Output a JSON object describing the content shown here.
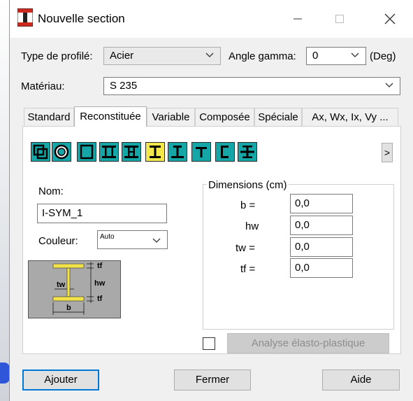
{
  "window": {
    "title": "Nouvelle section",
    "minimize": "—",
    "maximize": "☐",
    "close": "✕"
  },
  "profile_type": {
    "label": "Type de profilé:",
    "value": "Acier"
  },
  "angle_gamma": {
    "label": "Angle gamma:",
    "value": "0",
    "unit": "(Deg)"
  },
  "material": {
    "label": "Matériau:",
    "value": "S 235"
  },
  "tabs": [
    {
      "label": "Standard",
      "active": false
    },
    {
      "label": "Reconstituée",
      "active": true
    },
    {
      "label": "Variable",
      "active": false
    },
    {
      "label": "Composée",
      "active": false
    },
    {
      "label": "Spéciale",
      "active": false
    },
    {
      "label": "Ax, Wx, Ix, Vy ...",
      "active": false
    }
  ],
  "section_types": [
    {
      "icon": "box-section-icon",
      "selected": false
    },
    {
      "icon": "circular-tube-icon",
      "selected": false
    },
    {
      "icon": "rectangular-box-icon",
      "selected": false
    },
    {
      "icon": "double-web-box-icon",
      "selected": false
    },
    {
      "icon": "box-with-flanges-icon",
      "selected": false
    },
    {
      "icon": "i-symmetric-icon",
      "selected": true
    },
    {
      "icon": "i-asymmetric-icon",
      "selected": false
    },
    {
      "icon": "t-section-icon",
      "selected": false
    },
    {
      "icon": "c-channel-icon",
      "selected": false
    },
    {
      "icon": "cross-section-icon",
      "selected": false
    }
  ],
  "scroll_right": ">",
  "name": {
    "label": "Nom:",
    "value": "I-SYM_1"
  },
  "color": {
    "label": "Couleur:",
    "value": "Auto"
  },
  "diagram": {
    "tf_top": "tf",
    "hw": "hw",
    "tw": "tw",
    "tf_bottom": "tf",
    "b": "b"
  },
  "dimensions": {
    "legend": "Dimensions (cm)",
    "rows": [
      {
        "label": "b  =",
        "value": "0,0"
      },
      {
        "label": "hw",
        "value": "0,0"
      },
      {
        "label": "tw  =",
        "value": "0,0"
      },
      {
        "label": "tf  =",
        "value": "0,0"
      }
    ]
  },
  "plastic_analysis": {
    "label": "Analyse élasto-plastique",
    "checked": false,
    "enabled": false
  },
  "buttons": {
    "add": "Ajouter",
    "close": "Fermer",
    "help": "Aide"
  }
}
